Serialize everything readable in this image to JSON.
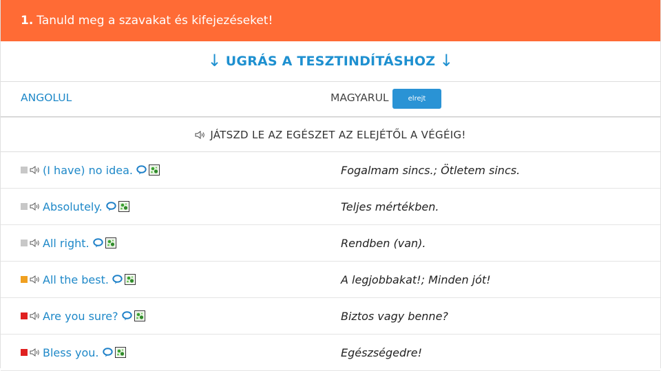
{
  "header": {
    "number": "1.",
    "title": "Tanuld meg a szavakat és kifejezéseket!",
    "color": "#ff6b35"
  },
  "jump": {
    "arrow_left": "↓",
    "label": "UGRÁS A TESZTINDÍTÁSHOZ",
    "arrow_right": "↓"
  },
  "columns": {
    "english": "ANGOLUL",
    "hungarian": "MAGYARUL",
    "hide_button": "elrejt"
  },
  "play_all": {
    "label": "JÁTSZD LE AZ EGÉSZET AZ ELEJÉTŐL A VÉGÉIG!"
  },
  "rows": [
    {
      "status_color": "#c8c8c8",
      "english": "(I have) no idea.",
      "hungarian": "Fogalmam sincs.; Ötletem sincs."
    },
    {
      "status_color": "#c8c8c8",
      "english": "Absolutely.",
      "hungarian": "Teljes mértékben."
    },
    {
      "status_color": "#c8c8c8",
      "english": "All right.",
      "hungarian": "Rendben (van)."
    },
    {
      "status_color": "#f0a020",
      "english": "All the best.",
      "hungarian": "A legjobbakat!; Minden jót!"
    },
    {
      "status_color": "#e02020",
      "english": "Are you sure?",
      "hungarian": "Biztos vagy benne?"
    },
    {
      "status_color": "#e02020",
      "english": "Bless you.",
      "hungarian": "Egészségedre!"
    }
  ]
}
